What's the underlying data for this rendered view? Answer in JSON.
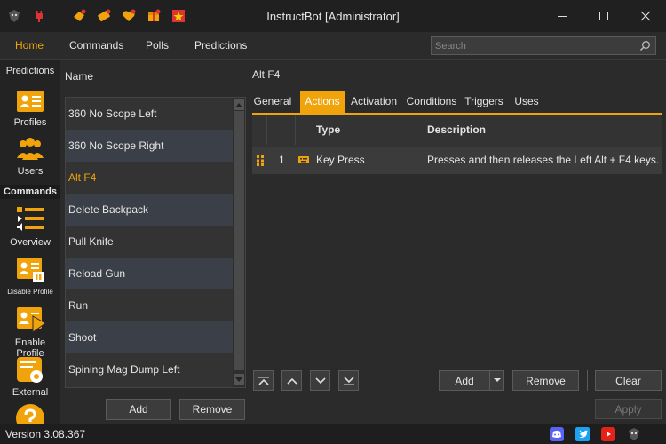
{
  "window": {
    "title": "InstructBot [Administrator]"
  },
  "menu": {
    "items": [
      "Home",
      "Commands",
      "Polls",
      "Predictions"
    ],
    "search_placeholder": "Search"
  },
  "leftnav": {
    "items": [
      "Predictions",
      "Profiles",
      "Users",
      "Overview",
      "Disable Profile",
      "Enable Profile",
      "External"
    ],
    "section": "Commands"
  },
  "list": {
    "header": "Name",
    "rows": [
      "360 No Scope Left",
      "360 No Scope Right",
      "Alt F4",
      "Delete Backpack",
      "Pull Knife",
      "Reload Gun",
      "Run",
      "Shoot",
      "Spining Mag Dump Left"
    ],
    "selected": "Alt F4",
    "add_label": "Add",
    "remove_label": "Remove"
  },
  "detail": {
    "title": "Alt F4",
    "tabs": [
      "General",
      "Actions",
      "Activation",
      "Conditions",
      "Triggers",
      "Uses"
    ],
    "active_tab": "Actions",
    "columns": {
      "type": "Type",
      "description": "Description"
    },
    "rows": [
      {
        "index": "1",
        "type": "Key Press",
        "description": "Presses and then releases the Left Alt + F4 keys."
      }
    ],
    "add_label": "Add",
    "remove_label": "Remove",
    "clear_label": "Clear",
    "apply_label": "Apply"
  },
  "status": {
    "version": "Version 3.08.367"
  },
  "colors": {
    "accent": "#f0a30a",
    "background": "#2b2b2b",
    "titlebar": "#202020"
  }
}
